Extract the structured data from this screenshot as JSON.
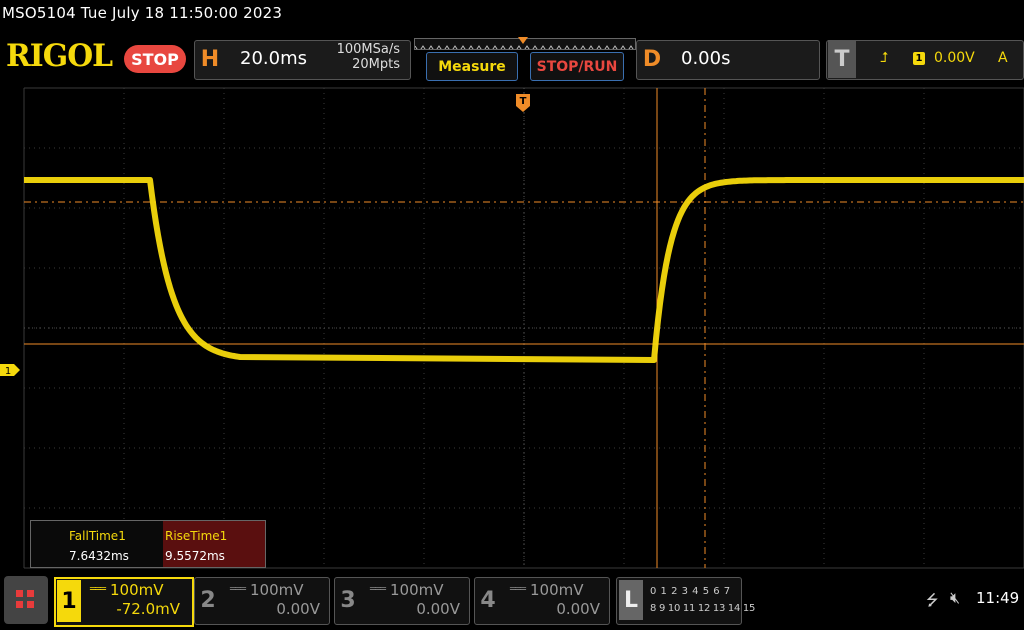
{
  "header": {
    "title_line": "MSO5104  Tue July 18 11:50:00 2023",
    "brand": "RIGOL",
    "run_state": "STOP"
  },
  "horizontal": {
    "letter": "H",
    "time_scale": "20.0ms",
    "sample_rate": "100MSa/s",
    "memory_depth": "20Mpts"
  },
  "buttons": {
    "measure": "Measure",
    "stop_run": "STOP/RUN"
  },
  "delay": {
    "letter": "D",
    "value": "0.00s"
  },
  "trigger": {
    "letter": "T",
    "edge_icon": "rising-edge-icon",
    "channel": "1",
    "level": "0.00V",
    "mode": "A"
  },
  "markers": {
    "trigger_pos": "T",
    "ch1_ground": "1"
  },
  "measurements": {
    "items": [
      {
        "label": "FallTime1",
        "value": "7.6432ms"
      },
      {
        "label": "RiseTime1",
        "value": "9.5572ms"
      }
    ]
  },
  "channels": [
    {
      "num": "1",
      "scale": "100mV",
      "offset": "-72.0mV",
      "active": true,
      "color": "#f5d90c"
    },
    {
      "num": "2",
      "scale": "100mV",
      "offset": "0.00V",
      "active": false,
      "color": "#888888"
    },
    {
      "num": "3",
      "scale": "100mV",
      "offset": "0.00V",
      "active": false,
      "color": "#888888"
    },
    {
      "num": "4",
      "scale": "100mV",
      "offset": "0.00V",
      "active": false,
      "color": "#888888"
    }
  ],
  "logic": {
    "letter": "L",
    "row1": "0 1 2 3  4 5 6 7",
    "row2": "8 9 10 11 12 13 14 15"
  },
  "status": {
    "usb_icon": "usb-icon",
    "speaker_icon": "speaker-muted-icon",
    "clock": "11:49"
  },
  "colors": {
    "trace": "#f5d90c",
    "cursor": "#f08c28",
    "brand": "#f5d90c",
    "stop": "#e8473f"
  }
}
